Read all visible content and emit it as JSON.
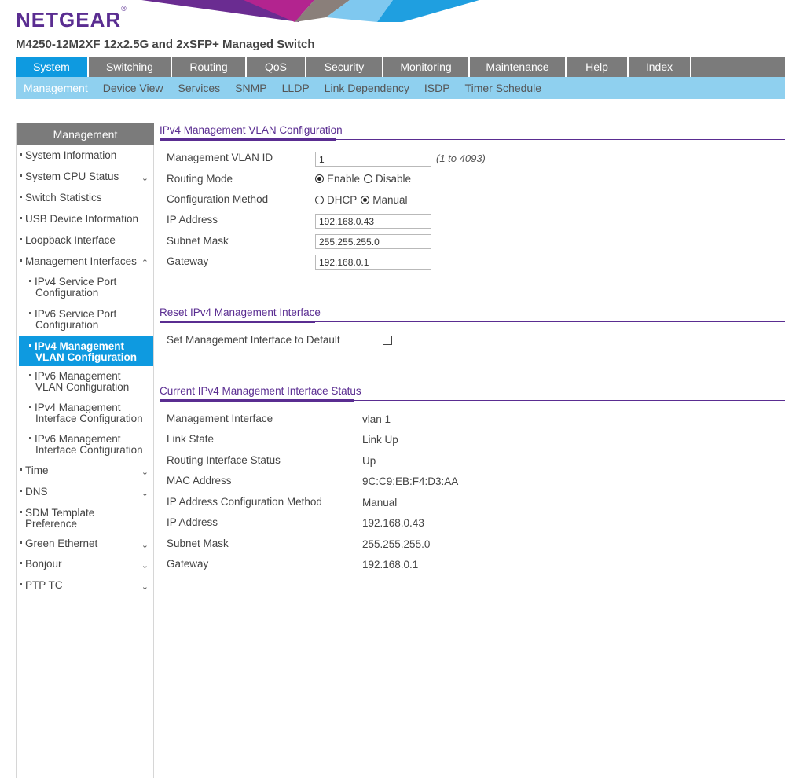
{
  "header": {
    "brand": "NETGEAR",
    "trademark": "®",
    "model": "M4250-12M2XF 12x2.5G and 2xSFP+ Managed Switch"
  },
  "topnav": {
    "tabs": [
      "System",
      "Switching",
      "Routing",
      "QoS",
      "Security",
      "Monitoring",
      "Maintenance",
      "Help",
      "Index"
    ],
    "active": "System"
  },
  "subnav": {
    "items": [
      "Management",
      "Device View",
      "Services",
      "SNMP",
      "LLDP",
      "Link Dependency",
      "ISDP",
      "Timer Schedule"
    ],
    "active": "Management"
  },
  "sidebar": {
    "header": "Management",
    "items": [
      "System Information",
      "System CPU Status",
      "Switch Statistics",
      "USB Device Information",
      "Loopback Interface",
      "Management Interfaces",
      "Time",
      "DNS",
      "SDM Template",
      "Preference",
      "Green Ethernet",
      "Bonjour",
      "PTP TC"
    ],
    "subitems": [
      {
        "line1": "IPv4 Service Port",
        "line2": "Configuration"
      },
      {
        "line1": "IPv6 Service Port",
        "line2": "Configuration"
      },
      {
        "line1": "IPv4 Management",
        "line2": "VLAN Configuration"
      },
      {
        "line1": "IPv6 Management",
        "line2": "VLAN Configuration"
      },
      {
        "line1": "IPv4 Management",
        "line2": "Interface Configuration"
      },
      {
        "line1": "IPv6 Management",
        "line2": "Interface Configuration"
      }
    ],
    "active_subitem": "IPv4 Management VLAN Configuration"
  },
  "vlan_config": {
    "title": "IPv4 Management VLAN Configuration",
    "mgmt_vlan_label": "Management VLAN ID",
    "mgmt_vlan_value": "1",
    "mgmt_vlan_hint": "(1 to 4093)",
    "routing_mode_label": "Routing Mode",
    "routing_enable": "Enable",
    "routing_disable": "Disable",
    "routing_selected": "Enable",
    "config_method_label": "Configuration Method",
    "config_dhcp": "DHCP",
    "config_manual": "Manual",
    "config_selected": "Manual",
    "ip_label": "IP Address",
    "ip_value": "192.168.0.43",
    "subnet_label": "Subnet Mask",
    "subnet_value": "255.255.255.0",
    "gateway_label": "Gateway",
    "gateway_value": "192.168.0.1"
  },
  "reset": {
    "title": "Reset IPv4 Management Interface",
    "default_label": "Set Management Interface to Default",
    "checked": false
  },
  "status": {
    "title": "Current IPv4 Management Interface Status",
    "rows": [
      {
        "label": "Management Interface",
        "value": "vlan 1"
      },
      {
        "label": "Link State",
        "value": "Link Up"
      },
      {
        "label": "Routing Interface Status",
        "value": "Up"
      },
      {
        "label": "MAC Address",
        "value": "9C:C9:EB:F4:D3:AA"
      },
      {
        "label": "IP Address Configuration Method",
        "value": "Manual"
      },
      {
        "label": "IP Address",
        "value": "192.168.0.43"
      },
      {
        "label": "Subnet Mask",
        "value": "255.255.255.0"
      },
      {
        "label": "Gateway",
        "value": "192.168.0.1"
      }
    ]
  },
  "colors": {
    "brand_purple": "#5a2d91",
    "active_blue": "#0e9ae0",
    "subnav_blue": "#8fd0ef",
    "nav_gray": "#7b7b7b"
  }
}
